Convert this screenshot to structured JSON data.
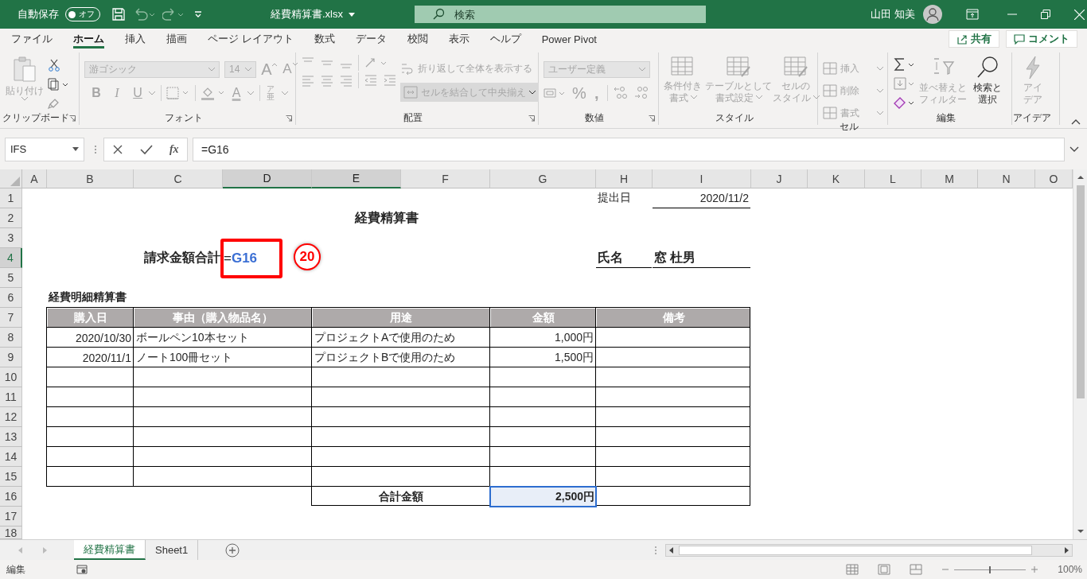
{
  "title_bar": {
    "autosave_label": "自動保存",
    "autosave": {
      "label": "オフ",
      "on": false
    },
    "filename": "経費精算書.xlsx",
    "search_placeholder": "検索",
    "user": "山田 知美"
  },
  "tabs": [
    {
      "label": "ファイル",
      "selected": false
    },
    {
      "label": "ホーム",
      "selected": true
    },
    {
      "label": "挿入",
      "selected": false
    },
    {
      "label": "描画",
      "selected": false
    },
    {
      "label": "ページ レイアウト",
      "selected": false
    },
    {
      "label": "数式",
      "selected": false
    },
    {
      "label": "データ",
      "selected": false
    },
    {
      "label": "校閲",
      "selected": false
    },
    {
      "label": "表示",
      "selected": false
    },
    {
      "label": "ヘルプ",
      "selected": false
    },
    {
      "label": "Power Pivot",
      "selected": false
    }
  ],
  "share": "共有",
  "comment": "コメント",
  "ribbon": {
    "clipboard": {
      "label": "クリップボード",
      "paste": {
        "label": "貼り付け",
        "disabled": true
      }
    },
    "font": {
      "label": "フォント",
      "disabled": true,
      "font_name": "游ゴシック",
      "font_size": "14",
      "grow": "A",
      "shrink": "A",
      "bold": "B",
      "italic": "I",
      "underline": "U",
      "font_color": "A",
      "phonetic": [
        "ア",
        "亜"
      ]
    },
    "alignment": {
      "label": "配置",
      "disabled": true,
      "wrap": "折り返して全体を表示する",
      "merge": "セルを結合して中央揃え"
    },
    "number": {
      "label": "数値",
      "disabled": true,
      "format": "ユーザー定義",
      "percent": "%",
      "comma": ","
    },
    "styles": {
      "label": "スタイル",
      "disabled": true,
      "buttons": [
        {
          "lines": [
            "条件付き",
            "書式"
          ]
        },
        {
          "lines": [
            "テーブルとして",
            "書式設定"
          ]
        },
        {
          "lines": [
            "セルの",
            "スタイル"
          ]
        }
      ]
    },
    "cells": {
      "label": "セル",
      "disabled": true,
      "buttons": [
        "挿入",
        "削除",
        "書式"
      ]
    },
    "editing": {
      "label": "編集",
      "sort": {
        "lines": [
          "並べ替えと",
          "フィルター"
        ],
        "disabled": true
      },
      "find": {
        "lines": [
          "検索と",
          "選択"
        ],
        "disabled": false
      }
    },
    "ideas": {
      "label": "アイデア",
      "disabled": true,
      "lines": [
        "アイ",
        "デア"
      ]
    }
  },
  "formula_bar": {
    "name_box": "IFS",
    "fx": "fx",
    "formula": "=G16"
  },
  "columns": [
    {
      "label": "A",
      "selected": false
    },
    {
      "label": "B",
      "selected": false
    },
    {
      "label": "C",
      "selected": false
    },
    {
      "label": "D",
      "selected": true
    },
    {
      "label": "E",
      "selected": true
    },
    {
      "label": "F",
      "selected": false
    },
    {
      "label": "G",
      "selected": false
    },
    {
      "label": "H",
      "selected": false
    },
    {
      "label": "I",
      "selected": false
    },
    {
      "label": "J",
      "selected": false
    },
    {
      "label": "K",
      "selected": false
    },
    {
      "label": "L",
      "selected": false
    },
    {
      "label": "M",
      "selected": false
    },
    {
      "label": "N",
      "selected": false
    },
    {
      "label": "O",
      "selected": false
    }
  ],
  "rows": [
    {
      "label": "1",
      "selected": false
    },
    {
      "label": "2",
      "selected": false
    },
    {
      "label": "3",
      "selected": false
    },
    {
      "label": "4",
      "selected": true
    },
    {
      "label": "5",
      "selected": false
    },
    {
      "label": "6",
      "selected": false
    },
    {
      "label": "7",
      "selected": false
    },
    {
      "label": "8",
      "selected": false
    },
    {
      "label": "9",
      "selected": false
    },
    {
      "label": "10",
      "selected": false
    },
    {
      "label": "11",
      "selected": false
    },
    {
      "label": "12",
      "selected": false
    },
    {
      "label": "13",
      "selected": false
    },
    {
      "label": "14",
      "selected": false
    },
    {
      "label": "15",
      "selected": false
    },
    {
      "label": "16",
      "selected": false
    },
    {
      "label": "17",
      "selected": false
    },
    {
      "label": "18",
      "selected": false
    }
  ],
  "sheet": {
    "date_label": "提出日",
    "date": "2020/11/2",
    "title": "経費精算書",
    "claim": {
      "label": "請求金額合計",
      "operator": "=",
      "reference": "G16",
      "highlighted": true,
      "step": "20"
    },
    "name_label": "氏名",
    "name": "窓 杜男",
    "table_title": "経費明細精算書",
    "table": {
      "columns": [
        "購入日",
        "事由（購入物品名）",
        "用途",
        "金額",
        "備考"
      ],
      "rows": [
        {
          "date": "2020/10/30",
          "item": "ボールペン10本セット",
          "purpose": "プロジェクトAで使用のため",
          "amount": "1,000円"
        },
        {
          "date": "2020/11/1",
          "item": "ノート100冊セット",
          "purpose": "プロジェクトBで使用のため",
          "amount": "1,500円"
        }
      ]
    },
    "total": {
      "label": "合計金額",
      "value": "2,500円",
      "selected": true
    }
  },
  "sheet_tabs": [
    {
      "label": "経費精算書",
      "selected": true
    },
    {
      "label": "Sheet1",
      "selected": false
    }
  ],
  "status_bar": {
    "mode": "編集",
    "zoom_slider": {
      "level": 0.5
    },
    "zoom": "100%"
  }
}
